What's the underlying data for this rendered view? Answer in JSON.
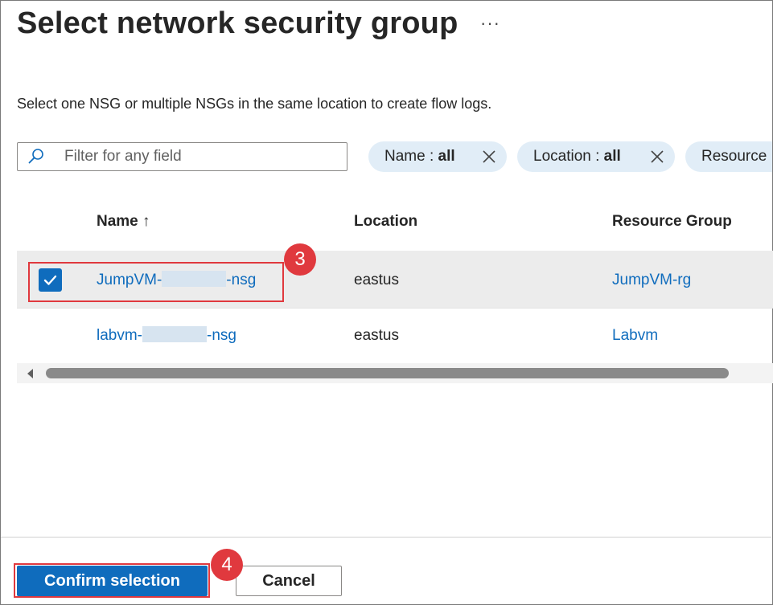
{
  "header": {
    "title": "Select network security group",
    "more_label": "···"
  },
  "description": "Select one NSG or multiple NSGs in the same location to create flow logs.",
  "filter": {
    "placeholder": "Filter for any field",
    "value": ""
  },
  "pills": [
    {
      "label": "Name : ",
      "value": "all"
    },
    {
      "label": "Location : ",
      "value": "all"
    },
    {
      "label": "Resource",
      "value": ""
    }
  ],
  "table": {
    "columns": [
      "Name ↑",
      "Location",
      "Resource Group"
    ],
    "rows": [
      {
        "name_prefix": "JumpVM-",
        "name_suffix": "-nsg",
        "location": "eastus",
        "resource_group": "JumpVM-rg",
        "selected": true
      },
      {
        "name_prefix": "labvm-",
        "name_suffix": "-nsg",
        "location": "eastus",
        "resource_group": "Labvm",
        "selected": false
      }
    ]
  },
  "annotations": {
    "step3": "3",
    "step4": "4",
    "highlight_color": "#e0393e"
  },
  "footer": {
    "confirm_label": "Confirm selection",
    "cancel_label": "Cancel"
  },
  "colors": {
    "accent": "#0f6cbd",
    "pill_bg": "#e1edf7",
    "selected_row_bg": "#ececec"
  },
  "icons": [
    "search-icon",
    "ellipsis-icon",
    "close-icon",
    "checkmark-icon",
    "sort-up-icon",
    "scroll-left-icon"
  ]
}
